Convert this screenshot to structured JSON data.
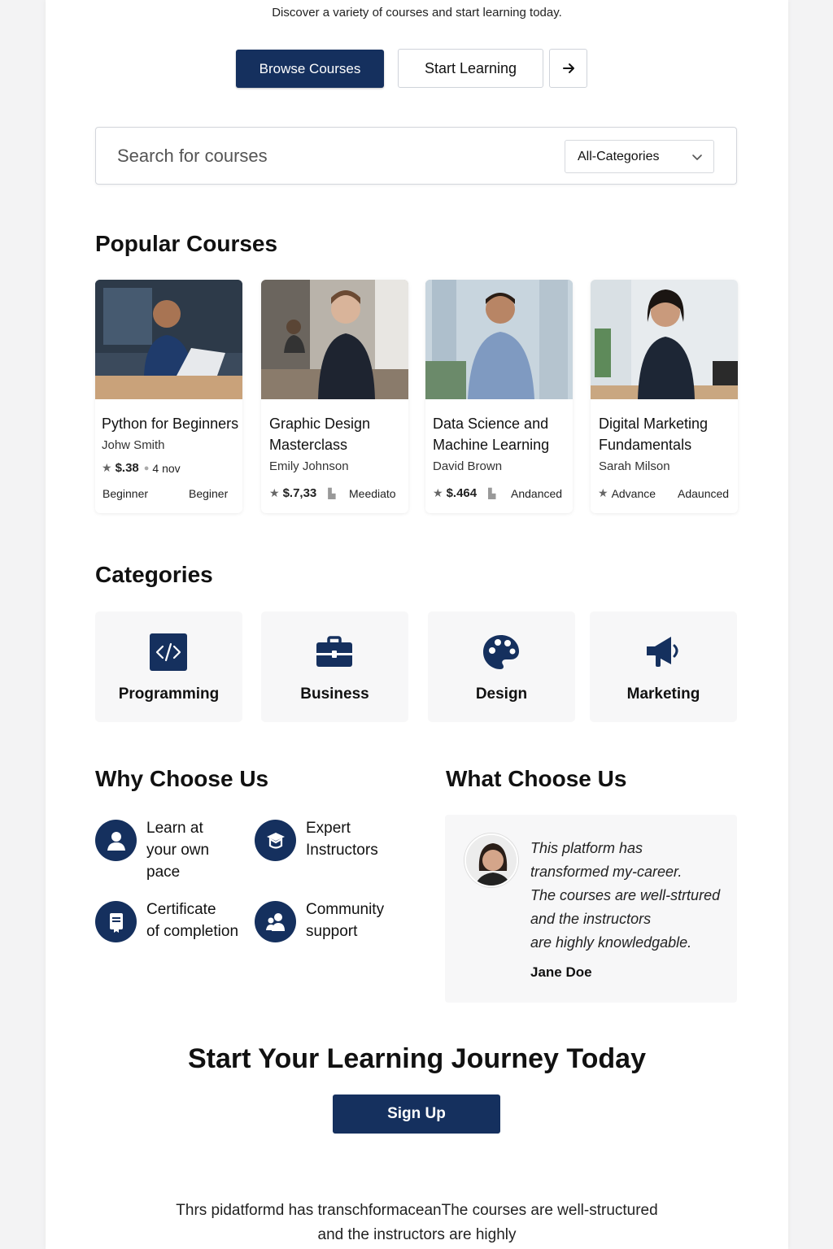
{
  "hero": {
    "subtitle": "Discover a variety of courses and start learning today.",
    "browse_label": "Browse Courses",
    "start_label": "Start Learning"
  },
  "search": {
    "placeholder": "Search for courses",
    "category_selected": "All-Categories"
  },
  "popular": {
    "title": "Popular Courses",
    "courses": [
      {
        "title": "Python for Beginners",
        "instructor": "Johw Smith",
        "price": "$.38",
        "extra": "4 nov",
        "level_left": "Beginner",
        "level_right": "Beginer"
      },
      {
        "title": "Graphic Design Masterclass",
        "instructor": "Emily Johnson",
        "price": "$.7,33",
        "level_right": "Meediato"
      },
      {
        "title": "Data Science and Machine Learning",
        "instructor": "David Brown",
        "price": "$.464",
        "level_right": "Andanced"
      },
      {
        "title": "Digital Marketing Fundamentals",
        "instructor": "Sarah Milson",
        "price": "Advance",
        "level_right": "Adaunced"
      }
    ]
  },
  "categories": {
    "title": "Categories",
    "items": [
      {
        "label": "Programming",
        "icon": "code-icon"
      },
      {
        "label": "Business",
        "icon": "briefcase-icon"
      },
      {
        "label": "Design",
        "icon": "palette-icon"
      },
      {
        "label": "Marketing",
        "icon": "megaphone-icon"
      }
    ]
  },
  "why": {
    "title": "Why Choose Us",
    "features": [
      {
        "line1": "Learn at",
        "line2": "your own",
        "line3": "pace",
        "icon": "user-icon"
      },
      {
        "line1": "Expert",
        "line2": "Instructors",
        "icon": "graduation-icon"
      },
      {
        "line1": "Certificate",
        "line2": "of completion",
        "icon": "certificate-icon"
      },
      {
        "line1": "Community",
        "line2": "support",
        "icon": "community-icon"
      }
    ]
  },
  "testimonial": {
    "title": "What Choose Us",
    "lines": [
      "This platform has",
      "transformed my-career.",
      "The courses are well-strtured",
      "and the instructors",
      "are highly knowledgable."
    ],
    "name": "Jane Doe"
  },
  "cta": {
    "title": "Start Your Learning Journey Today",
    "signup_label": "Sign Up"
  },
  "footer": {
    "line1": "Thrs pidatformd has transchformaceanThe courses are well-structured",
    "line2": "and the instructors are highly"
  },
  "colors": {
    "primary": "#15305e",
    "background": "#f3f3f4"
  }
}
